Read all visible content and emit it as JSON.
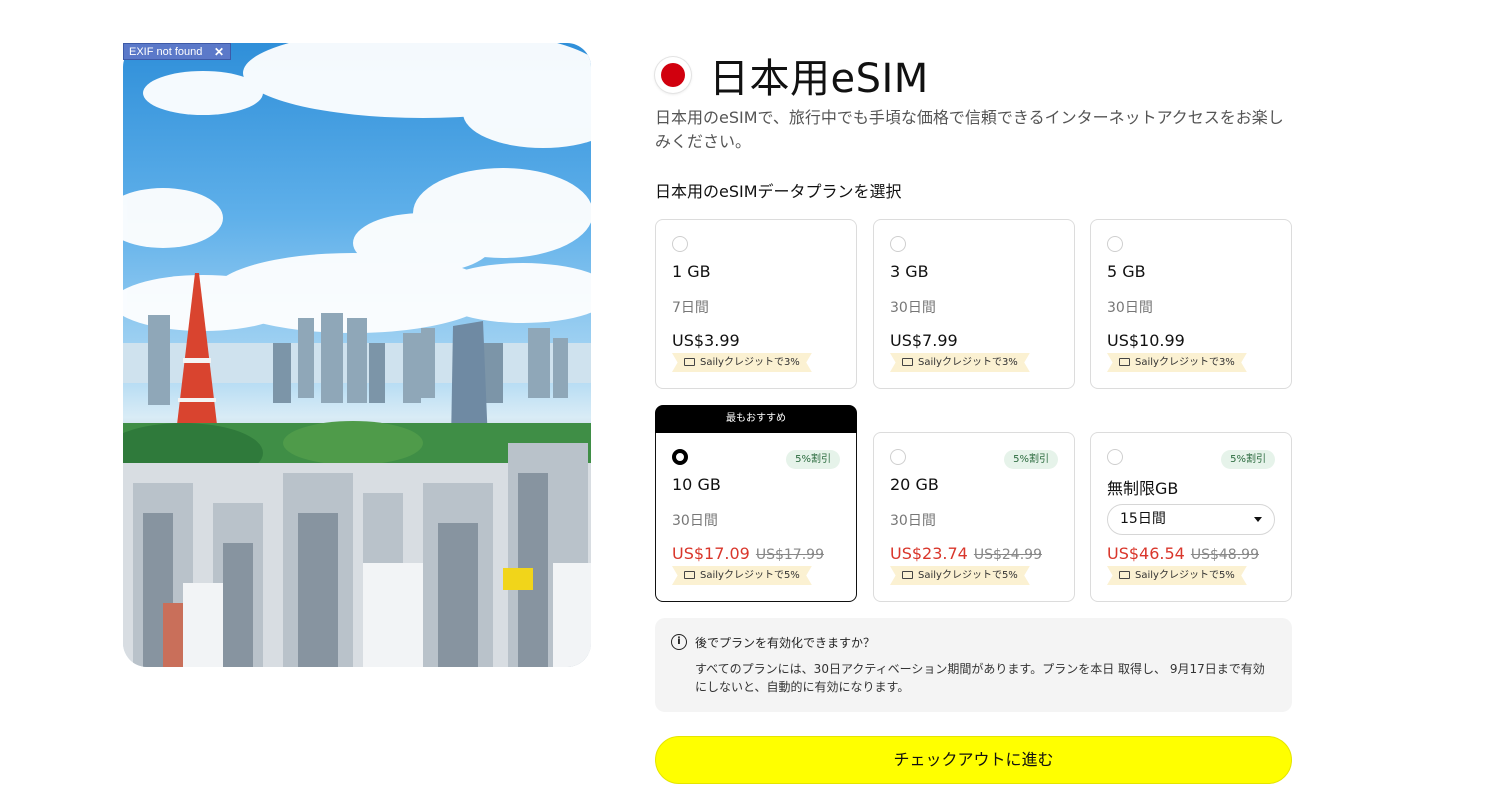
{
  "exif_badge": {
    "label": "EXIF not found",
    "close": "✕"
  },
  "header": {
    "title": "日本用eSIM",
    "description": "日本用のeSIMで、旅行中でも手頃な価格で信頼できるインターネットアクセスをお楽しみください。",
    "select_label": "日本用のeSIMデータプランを選択"
  },
  "plans": [
    {
      "data": "1 GB",
      "duration": "7日間",
      "price": "US$3.99",
      "credit": "Sailyクレジットで3%"
    },
    {
      "data": "3 GB",
      "duration": "30日間",
      "price": "US$7.99",
      "credit": "Sailyクレジットで3%"
    },
    {
      "data": "5 GB",
      "duration": "30日間",
      "price": "US$10.99",
      "credit": "Sailyクレジットで3%"
    },
    {
      "data": "10 GB",
      "duration": "30日間",
      "price": "US$17.09",
      "old_price": "US$17.99",
      "discount": "5%割引",
      "credit": "Sailyクレジットで5%",
      "ribbon": "最もおすすめ",
      "selected": true
    },
    {
      "data": "20 GB",
      "duration": "30日間",
      "price": "US$23.74",
      "old_price": "US$24.99",
      "discount": "5%割引",
      "credit": "Sailyクレジットで5%"
    },
    {
      "data": "無制限GB",
      "duration_select": "15日間",
      "price": "US$46.54",
      "old_price": "US$48.99",
      "discount": "5%割引",
      "credit": "Sailyクレジットで5%"
    }
  ],
  "info": {
    "question": "後でプランを有効化できますか？",
    "answer": "すべてのプランには、30日アクティベーション期間があります。プランを本日 取得し、 9月17日まで有効にしないと、自動的に有効になります。"
  },
  "cta": {
    "label": "チェックアウトに進む"
  },
  "colors": {
    "accent": "#ffff00",
    "sale": "#d9362b",
    "discount_bg": "#e6f3ea",
    "credit_bg": "#fbf1d2"
  }
}
